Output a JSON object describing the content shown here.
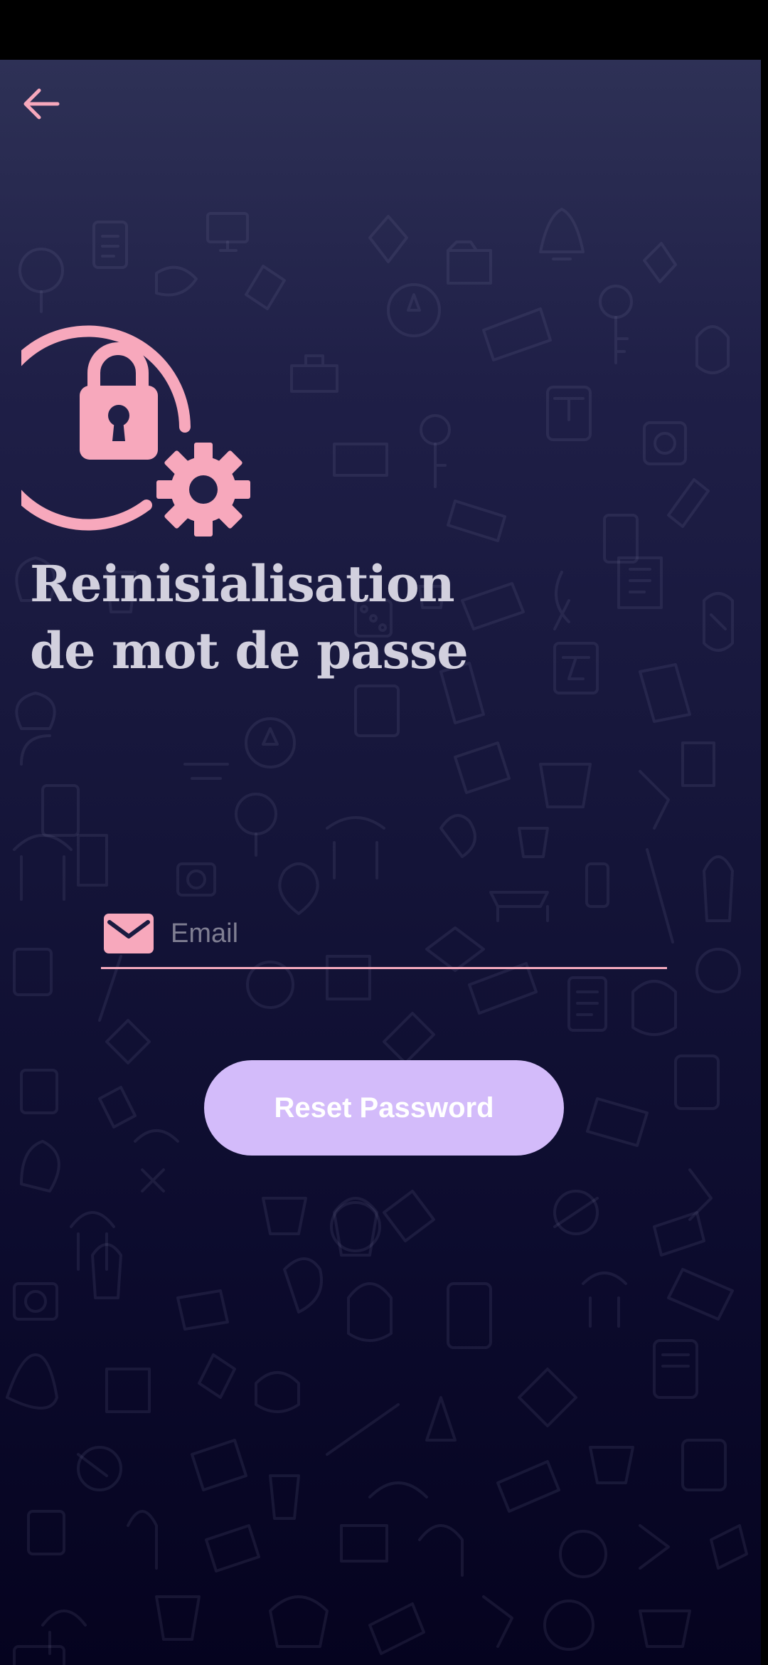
{
  "header": {
    "back_icon": "arrow-left-icon"
  },
  "hero": {
    "icon": "lock-settings-icon"
  },
  "title": {
    "line1": "Reinisialisation",
    "line2": "de mot de passe"
  },
  "form": {
    "email_icon": "envelope-icon",
    "email_placeholder": "Email",
    "email_value": "",
    "submit_label": "Reset Password"
  },
  "colors": {
    "accent_pink": "#f7a8bc",
    "button_bg": "#d3bbfa",
    "title_text": "#d2d0de"
  }
}
